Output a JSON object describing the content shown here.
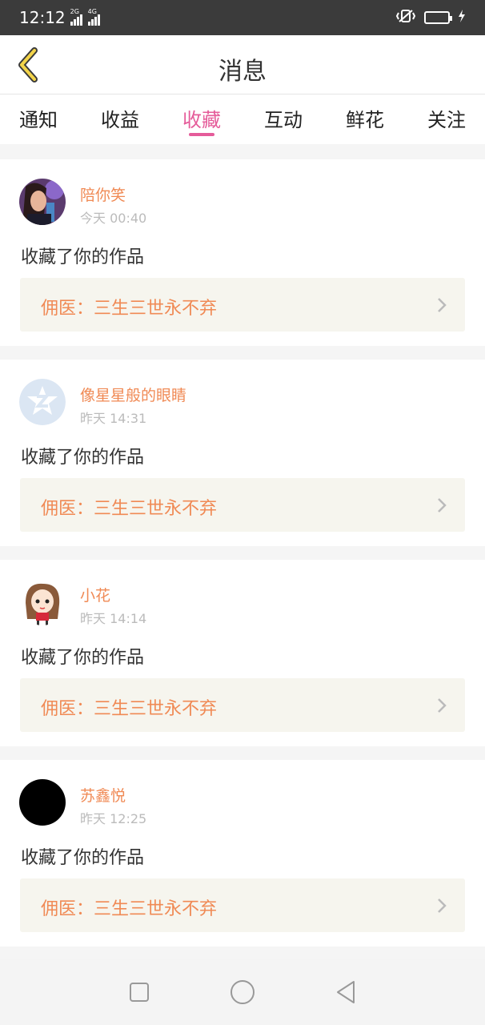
{
  "status_bar": {
    "time": "12:12",
    "net1": "2G",
    "net2": "4G"
  },
  "header": {
    "title": "消息"
  },
  "tabs": [
    {
      "label": "通知"
    },
    {
      "label": "收益"
    },
    {
      "label": "收藏",
      "active": true
    },
    {
      "label": "互动"
    },
    {
      "label": "鲜花"
    },
    {
      "label": "关注"
    }
  ],
  "messages": [
    {
      "username": "陪你笑",
      "time": "今天 00:40",
      "action": "收藏了你的作品",
      "work_title": "佣医：三生三世永不弃",
      "avatar": "photo-avatar"
    },
    {
      "username": "像星星般的眼睛",
      "time": "昨天 14:31",
      "action": "收藏了你的作品",
      "work_title": "佣医：三生三世永不弃",
      "avatar": "default-qq-avatar"
    },
    {
      "username": "小花",
      "time": "昨天 14:14",
      "action": "收藏了你的作品",
      "work_title": "佣医：三生三世永不弃",
      "avatar": "cartoon-girl-avatar"
    },
    {
      "username": "苏鑫悦",
      "time": "昨天 12:25",
      "action": "收藏了你的作品",
      "work_title": "佣医：三生三世永不弃",
      "avatar": "black-avatar"
    }
  ],
  "colors": {
    "accent": "#e55c9a",
    "username": "#f08a55",
    "link_bg": "#f6f5ee"
  }
}
